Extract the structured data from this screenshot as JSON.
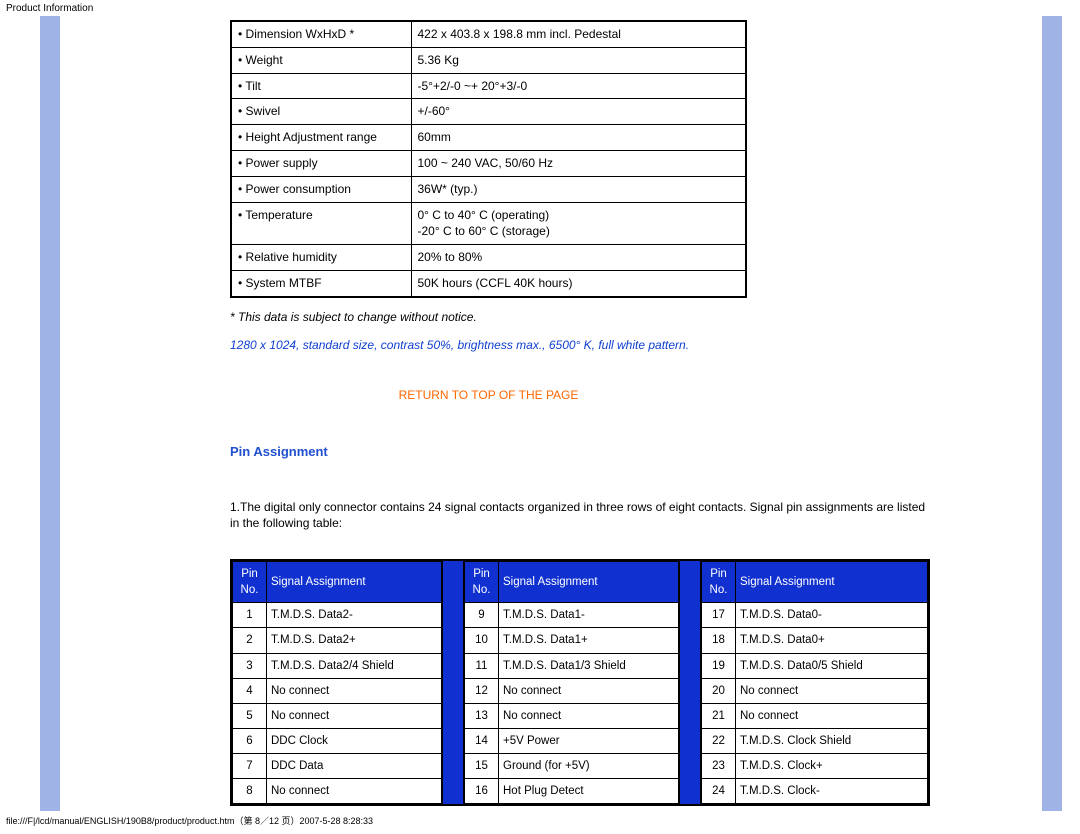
{
  "page_title": "Product Information",
  "spec_rows": [
    {
      "label": "• Dimension WxHxD *",
      "value": "422 x 403.8 x 198.8 mm incl. Pedestal"
    },
    {
      "label": "• Weight",
      "value": "5.36 Kg"
    },
    {
      "label": "• Tilt",
      "value": "-5°+2/-0 ~+ 20°+3/-0"
    },
    {
      "label": "• Swivel",
      "value": "+/-60°"
    },
    {
      "label": "• Height Adjustment range",
      "value": "60mm"
    },
    {
      "label": "• Power supply",
      "value": "100 ~ 240 VAC, 50/60 Hz"
    },
    {
      "label": "• Power consumption",
      "value": "36W* (typ.)"
    },
    {
      "label": "• Temperature",
      "value": "0° C to 40° C (operating)\n-20° C to 60° C (storage)"
    },
    {
      "label": "• Relative humidity",
      "value": "20% to 80%"
    },
    {
      "label": "• System MTBF",
      "value": "50K hours (CCFL 40K hours)"
    }
  ],
  "notice": "* This data is subject to change without notice.",
  "blue_note": "1280 x 1024, standard size, contrast 50%, brightness max., 6500° K, full white pattern.",
  "return_link": "RETURN TO TOP OF THE PAGE",
  "section_heading": "Pin Assignment",
  "pin_desc": "1.The digital only connector contains 24 signal contacts organized in three rows of eight contacts. Signal pin assignments are listed in the following table:",
  "pin_header_pin": "Pin No.",
  "pin_header_signal": "Signal Assignment",
  "pin_left": [
    {
      "pin": "1",
      "signal": "T.M.D.S. Data2-"
    },
    {
      "pin": "2",
      "signal": "T.M.D.S. Data2+"
    },
    {
      "pin": "3",
      "signal": "T.M.D.S. Data2/4 Shield"
    },
    {
      "pin": "4",
      "signal": "No connect"
    },
    {
      "pin": "5",
      "signal": "No connect"
    },
    {
      "pin": "6",
      "signal": "DDC Clock"
    },
    {
      "pin": "7",
      "signal": "DDC Data"
    },
    {
      "pin": "8",
      "signal": "No connect"
    }
  ],
  "pin_mid": [
    {
      "pin": "9",
      "signal": "T.M.D.S. Data1-"
    },
    {
      "pin": "10",
      "signal": "T.M.D.S. Data1+"
    },
    {
      "pin": "11",
      "signal": "T.M.D.S. Data1/3 Shield"
    },
    {
      "pin": "12",
      "signal": "No connect"
    },
    {
      "pin": "13",
      "signal": "No connect"
    },
    {
      "pin": "14",
      "signal": "+5V Power"
    },
    {
      "pin": "15",
      "signal": "Ground (for +5V)"
    },
    {
      "pin": "16",
      "signal": "Hot Plug Detect"
    }
  ],
  "pin_right": [
    {
      "pin": "17",
      "signal": "T.M.D.S. Data0-"
    },
    {
      "pin": "18",
      "signal": "T.M.D.S. Data0+"
    },
    {
      "pin": "19",
      "signal": "T.M.D.S. Data0/5 Shield"
    },
    {
      "pin": "20",
      "signal": "No connect"
    },
    {
      "pin": "21",
      "signal": "No connect"
    },
    {
      "pin": "22",
      "signal": "T.M.D.S. Clock Shield"
    },
    {
      "pin": "23",
      "signal": "T.M.D.S. Clock+"
    },
    {
      "pin": "24",
      "signal": "T.M.D.S. Clock-"
    }
  ],
  "footer": "file:///F|/lcd/manual/ENGLISH/190B8/product/product.htm（第 8／12 页）2007-5-28 8:28:33"
}
